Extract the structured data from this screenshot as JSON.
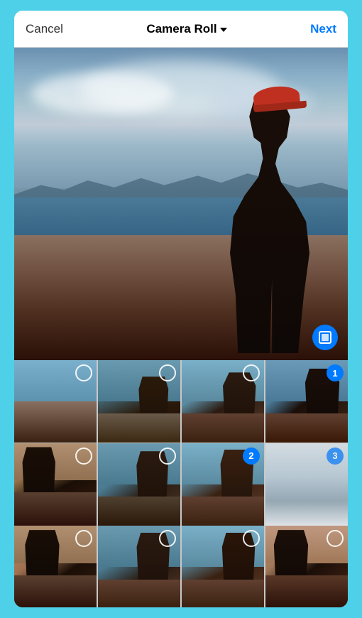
{
  "header": {
    "cancel_label": "Cancel",
    "title": "Camera Roll",
    "chevron": "chevron-down",
    "next_label": "Next"
  },
  "thumbnails": [
    {
      "id": 1,
      "bg": "thumb-bg-1",
      "selected": false,
      "badge": null
    },
    {
      "id": 2,
      "bg": "thumb-bg-2",
      "selected": false,
      "badge": null
    },
    {
      "id": 3,
      "bg": "thumb-bg-3",
      "selected": false,
      "badge": null
    },
    {
      "id": 4,
      "bg": "thumb-bg-4",
      "selected": true,
      "badge": "1"
    },
    {
      "id": 5,
      "bg": "thumb-bg-5",
      "selected": false,
      "badge": null
    },
    {
      "id": 6,
      "bg": "thumb-bg-6",
      "selected": false,
      "badge": null
    },
    {
      "id": 7,
      "bg": "thumb-bg-7",
      "selected": true,
      "badge": "2"
    },
    {
      "id": 8,
      "bg": "thumb-bg-8",
      "selected": true,
      "badge": "3",
      "faded": true
    },
    {
      "id": 9,
      "bg": "thumb-bg-9",
      "selected": false,
      "badge": null
    },
    {
      "id": 10,
      "bg": "thumb-bg-10",
      "selected": false,
      "badge": null
    },
    {
      "id": 11,
      "bg": "thumb-bg-11",
      "selected": false,
      "badge": null
    },
    {
      "id": 12,
      "bg": "thumb-bg-12",
      "selected": false,
      "badge": null
    }
  ],
  "expand_icon": "expand-square-icon",
  "colors": {
    "accent": "#007AFF",
    "background": "#4dd0e8"
  }
}
